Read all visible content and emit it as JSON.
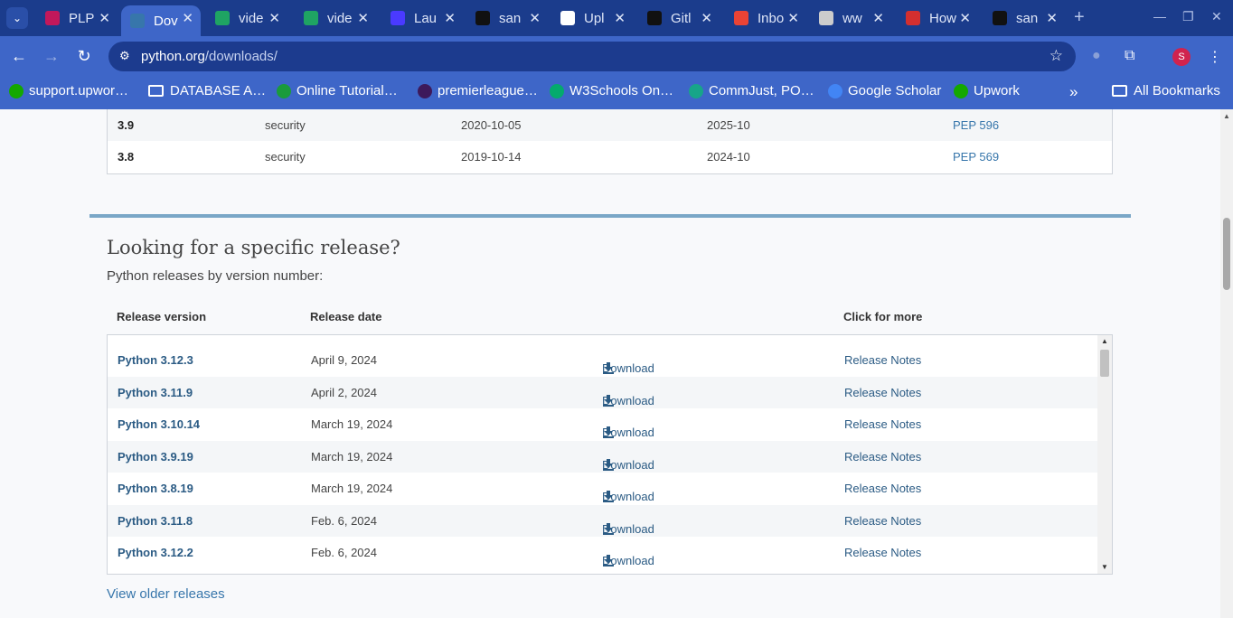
{
  "browser": {
    "tabs": [
      {
        "title": "PLP",
        "icon": "plp-favicon",
        "color": "#c2185b",
        "active": false
      },
      {
        "title": "Dov",
        "icon": "python-favicon",
        "color": "#3776ab",
        "active": true
      },
      {
        "title": "vide",
        "icon": "google-drive-favicon",
        "color": "#1fa463",
        "active": false
      },
      {
        "title": "vide",
        "icon": "google-drive-favicon",
        "color": "#1fa463",
        "active": false
      },
      {
        "title": "Lau",
        "icon": "zoom-favicon",
        "color": "#4a3aff",
        "active": false
      },
      {
        "title": "san",
        "icon": "github-favicon",
        "color": "#111111",
        "active": false
      },
      {
        "title": "Upl",
        "icon": "openai-favicon",
        "color": "#ffffff",
        "active": false
      },
      {
        "title": "Gitl",
        "icon": "github-favicon",
        "color": "#111111",
        "active": false
      },
      {
        "title": "Inbo",
        "icon": "gmail-favicon",
        "color": "#ea4335",
        "active": false
      },
      {
        "title": "ww",
        "icon": "globe-favicon",
        "color": "#cccccc",
        "active": false
      },
      {
        "title": "How",
        "icon": "red-square-favicon",
        "color": "#d32f2f",
        "active": false
      },
      {
        "title": "san",
        "icon": "github-favicon",
        "color": "#111111",
        "active": false
      }
    ],
    "url_host": "python.org",
    "url_path": "/downloads/",
    "profile_initial": "S",
    "bookmarks": [
      {
        "label": "support.upwor…",
        "icon": "upwork-icon",
        "color": "#14a800"
      },
      {
        "label": "DATABASE A…",
        "icon": "folder-icon",
        "color": ""
      },
      {
        "label": "Online Tutorial…",
        "icon": "tutorial-icon",
        "color": "#1a9b3c"
      },
      {
        "label": "premierleague…",
        "icon": "premierleague-icon",
        "color": "#3d195b"
      },
      {
        "label": "W3Schools On…",
        "icon": "w3schools-icon",
        "color": "#04aa6d"
      },
      {
        "label": "CommJust, PO…",
        "icon": "commjust-icon",
        "color": "#17a589"
      },
      {
        "label": "Google Scholar",
        "icon": "scholar-icon",
        "color": "#4285f4"
      },
      {
        "label": "Upwork",
        "icon": "upwork-icon",
        "color": "#14a800"
      }
    ],
    "all_bookmarks": "All Bookmarks"
  },
  "top_table": {
    "rows": [
      {
        "version": "3.9",
        "status": "security",
        "released": "2020-10-05",
        "eol": "2025-10",
        "pep": "PEP 596"
      },
      {
        "version": "3.8",
        "status": "security",
        "released": "2019-10-14",
        "eol": "2024-10",
        "pep": "PEP 569"
      }
    ]
  },
  "section": {
    "title": "Looking for a specific release?",
    "subtitle": "Python releases by version number:",
    "headers": {
      "version": "Release version",
      "date": "Release date",
      "more": "Click for more"
    },
    "releases": [
      {
        "version": "Python 3.12.3",
        "date": "April 9, 2024",
        "download": "Download",
        "notes": "Release Notes"
      },
      {
        "version": "Python 3.11.9",
        "date": "April 2, 2024",
        "download": "Download",
        "notes": "Release Notes"
      },
      {
        "version": "Python 3.10.14",
        "date": "March 19, 2024",
        "download": "Download",
        "notes": "Release Notes"
      },
      {
        "version": "Python 3.9.19",
        "date": "March 19, 2024",
        "download": "Download",
        "notes": "Release Notes"
      },
      {
        "version": "Python 3.8.19",
        "date": "March 19, 2024",
        "download": "Download",
        "notes": "Release Notes"
      },
      {
        "version": "Python 3.11.8",
        "date": "Feb. 6, 2024",
        "download": "Download",
        "notes": "Release Notes"
      },
      {
        "version": "Python 3.12.2",
        "date": "Feb. 6, 2024",
        "download": "Download",
        "notes": "Release Notes"
      }
    ],
    "older_link": "View older releases"
  }
}
